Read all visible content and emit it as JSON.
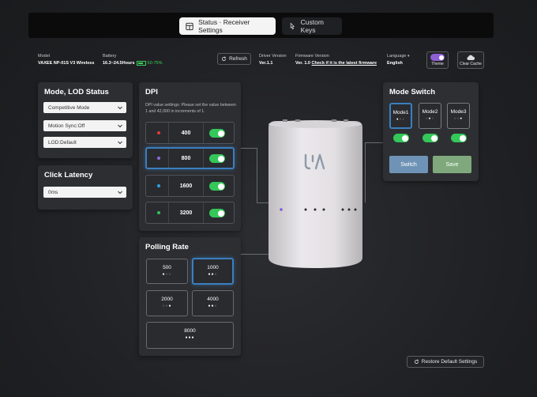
{
  "tabs": [
    {
      "label": "Status · Receiver Settings",
      "icon": "layout-icon",
      "active": true
    },
    {
      "label": "Custom Keys",
      "icon": "pointer-icon",
      "active": false
    }
  ],
  "info": {
    "model_label": "Model",
    "model_value": "VAXEE NP-01S V3 Wireless",
    "battery_label": "Battery",
    "battery_hours": "16.3~24.5Hours",
    "battery_percent": "50-75%",
    "refresh_label": "Refresh",
    "driver_label": "Driver Version",
    "driver_value": "Ver.1.1",
    "firmware_label": "Firmware Version",
    "firmware_value": "Ver. 1.0",
    "firmware_link": "Check if it is the latest firmware",
    "language_label": "Language",
    "language_value": "English",
    "theme_label": "Theme",
    "clear_cache_label": "Clear Cache"
  },
  "mode_lod": {
    "title": "Mode, LOD Status",
    "selects": [
      "Competitive Mode",
      "Motion Sync:Off",
      "LOD:Default"
    ]
  },
  "click_latency": {
    "title": "Click Latency",
    "value": "0ms"
  },
  "dpi": {
    "title": "DPI",
    "hint": "DPI value settings: Please set the value between 1 and 42,000 in increments of 1.",
    "rows": [
      {
        "value": "400",
        "color": "#e23b3b",
        "enabled": true
      },
      {
        "value": "800",
        "color": "#8a6be0",
        "enabled": true,
        "selected": true
      },
      {
        "value": "1600",
        "color": "#2aa3e8",
        "enabled": true
      },
      {
        "value": "3200",
        "color": "#2ec25a",
        "enabled": true
      }
    ]
  },
  "polling": {
    "title": "Polling Rate",
    "options": [
      {
        "value": "500",
        "dots": 1
      },
      {
        "value": "1000",
        "dots": 2,
        "selected": true
      },
      {
        "value": "2000",
        "dots": 1
      },
      {
        "value": "4000",
        "dots": 2
      },
      {
        "value": "8000",
        "dots": 3
      }
    ]
  },
  "mode_switch": {
    "title": "Mode Switch",
    "modes": [
      "Mode1",
      "Mode2",
      "Mode3"
    ],
    "switch_label": "Switch",
    "save_label": "Save"
  },
  "restore_label": "Restore Default Settings",
  "colors": {
    "accent": "#3a7fc0",
    "toggle_on": "#34c759",
    "switch_btn": "#6f93b6",
    "save_btn": "#7fa97c",
    "theme_toggle": "#8f5fd6"
  }
}
